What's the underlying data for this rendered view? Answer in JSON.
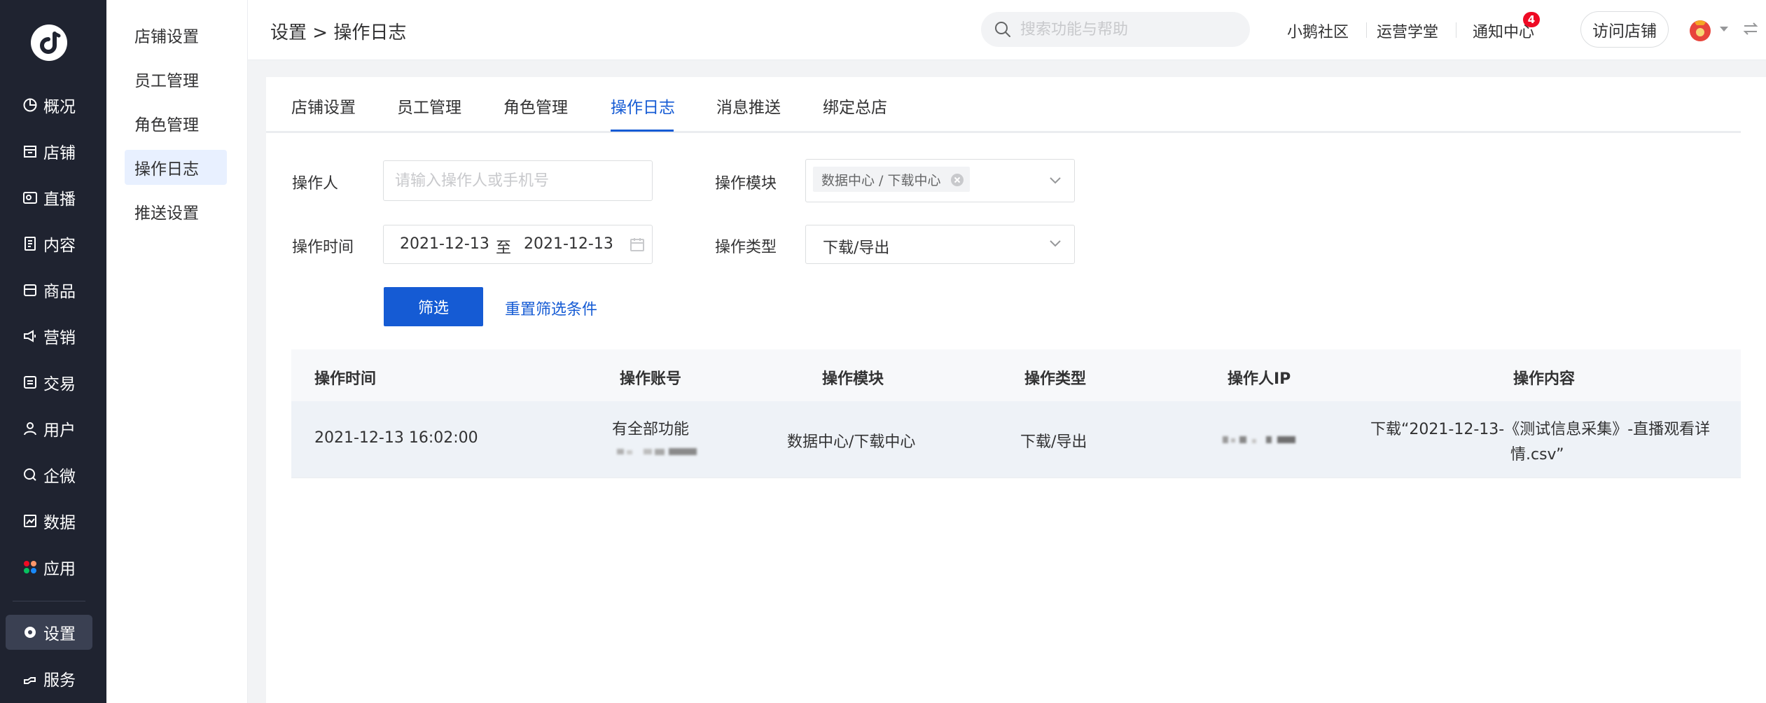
{
  "rail": {
    "items": [
      {
        "label": "概况",
        "icon": "overview-icon"
      },
      {
        "label": "店铺",
        "icon": "store-icon"
      },
      {
        "label": "直播",
        "icon": "live-icon"
      },
      {
        "label": "内容",
        "icon": "content-icon"
      },
      {
        "label": "商品",
        "icon": "goods-icon"
      },
      {
        "label": "营销",
        "icon": "marketing-icon"
      },
      {
        "label": "交易",
        "icon": "trade-icon"
      },
      {
        "label": "用户",
        "icon": "user-icon"
      },
      {
        "label": "企微",
        "icon": "wecom-icon"
      },
      {
        "label": "数据",
        "icon": "data-icon"
      },
      {
        "label": "应用",
        "icon": "apps-icon"
      },
      {
        "label": "设置",
        "icon": "gear-icon"
      },
      {
        "label": "服务",
        "icon": "service-icon"
      }
    ]
  },
  "subnav": {
    "items": [
      {
        "label": "店铺设置"
      },
      {
        "label": "员工管理"
      },
      {
        "label": "角色管理"
      },
      {
        "label": "操作日志"
      },
      {
        "label": "推送设置"
      }
    ]
  },
  "header": {
    "breadcrumb": "设置 > 操作日志",
    "search_placeholder": "搜索功能与帮助",
    "links": [
      "小鹅社区",
      "运营学堂",
      "通知中心"
    ],
    "notification_count": "4",
    "visit_store": "访问店铺"
  },
  "tabs": [
    "店铺设置",
    "员工管理",
    "角色管理",
    "操作日志",
    "消息推送",
    "绑定总店"
  ],
  "filters": {
    "operator_label": "操作人",
    "operator_placeholder": "请输入操作人或手机号",
    "module_label": "操作模块",
    "module_tag": "数据中心 / 下载中心",
    "time_label": "操作时间",
    "date_start": "2021-12-13",
    "date_to": "至",
    "date_end": "2021-12-13",
    "type_label": "操作类型",
    "type_value": "下载/导出",
    "filter_button": "筛选",
    "reset_link": "重置筛选条件"
  },
  "table": {
    "headers": [
      "操作时间",
      "操作账号",
      "操作模块",
      "操作类型",
      "操作人IP",
      "操作内容"
    ],
    "rows": [
      {
        "time": "2021-12-13 16:02:00",
        "account": "有全部功能",
        "module": "数据中心/下载中心",
        "type": "下载/导出",
        "content_line1": "下载“2021-12-13-《测试信息采集》-直播观看详",
        "content_line2": "情.csv”"
      }
    ]
  },
  "colors": {
    "accent": "#155bd4",
    "rail_bg": "#1f2330",
    "badge": "#ee0a24"
  }
}
